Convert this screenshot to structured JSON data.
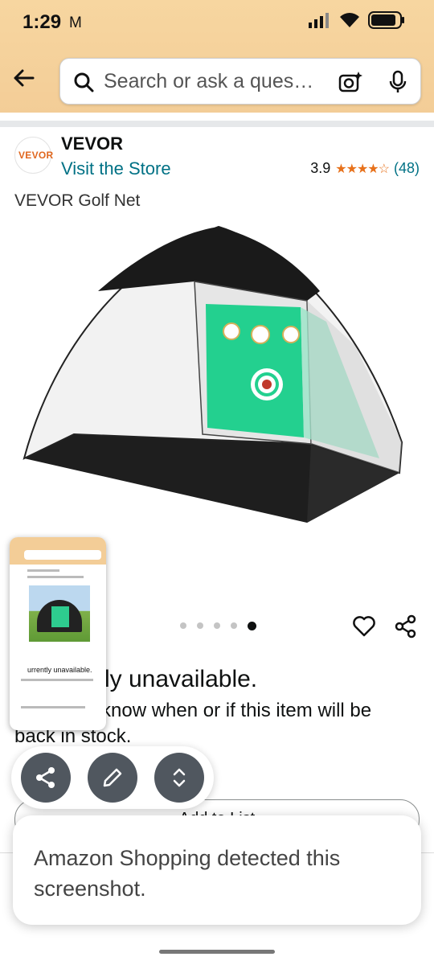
{
  "status_bar": {
    "time": "1:29",
    "mail_glyph": "M"
  },
  "search": {
    "placeholder": "Search or ask a ques…"
  },
  "store": {
    "logo_text": "VEVOR",
    "brand": "VEVOR",
    "visit_label": "Visit the Store",
    "rating": "3.9",
    "stars": "★★★★☆",
    "rating_count": "(48)"
  },
  "product": {
    "title": "VEVOR Golf Net",
    "image_count": 5,
    "active_image_index": 4
  },
  "availability": {
    "title": "ly unavailable.",
    "body_line1": "know when or if this item will be",
    "body_line2": "back in stock."
  },
  "actions": {
    "add_to_list": "Add to List"
  },
  "toast": {
    "message": "Amazon Shopping detected this screenshot."
  },
  "thumbnail": {
    "text": "urrently unavailable."
  },
  "colors": {
    "header": "#f3cd97",
    "link": "#007185",
    "star": "#e7711b",
    "fab": "#50575f"
  }
}
